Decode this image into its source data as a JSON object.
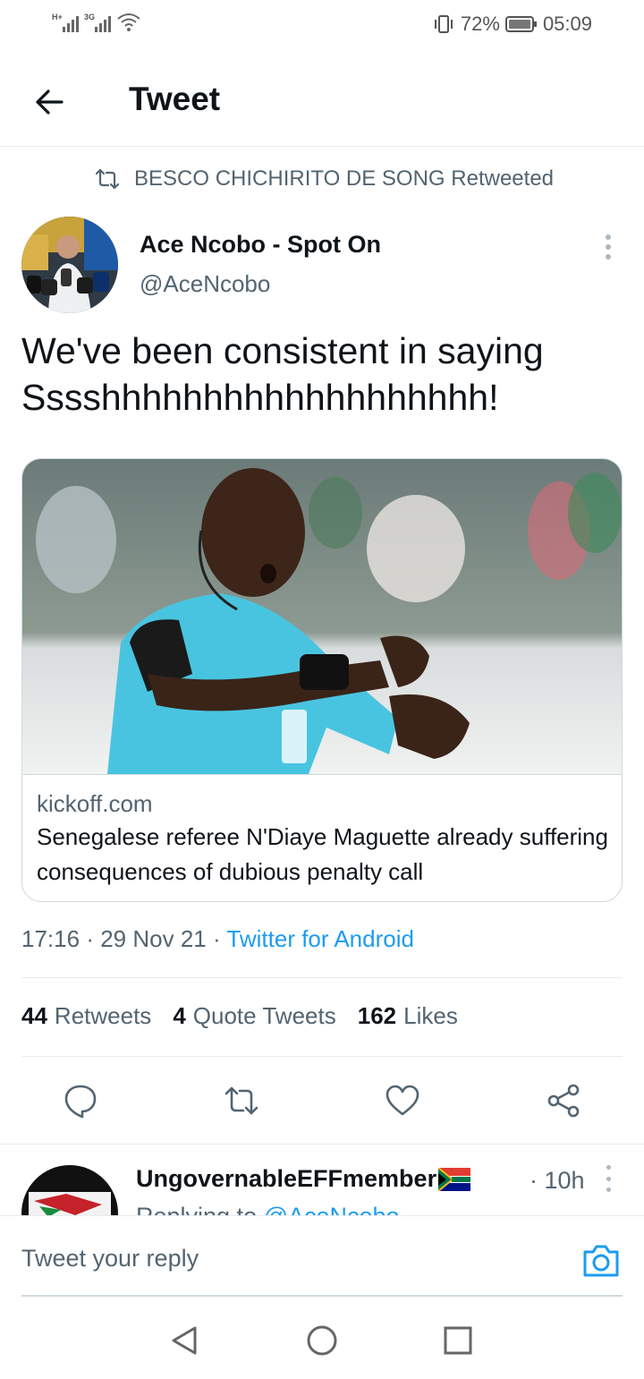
{
  "status_bar": {
    "network1": "H+",
    "network2": "3G",
    "battery": "72%",
    "time": "05:09"
  },
  "header": {
    "back_icon": "arrow-left-icon",
    "title": "Tweet"
  },
  "tweet": {
    "retweeted_by": "BESCO CHICHIRITO DE SONG Retweeted",
    "author_name": "Ace Ncobo - Spot On",
    "author_handle": "@AceNcobo",
    "text": "We've been consistent in saying Sssshhhhhhhhhhhhhhhhhhh!",
    "card": {
      "domain": "kickoff.com",
      "title": "Senegalese referee N'Diaye Maguette already suffering consequences of dubious penalty call"
    },
    "time": "17:16",
    "date": "29 Nov 21",
    "source": "Twitter for Android",
    "separator": "·",
    "stats": {
      "retweets_count": "44",
      "retweets_label": "Retweets",
      "quotes_count": "4",
      "quotes_label": "Quote Tweets",
      "likes_count": "162",
      "likes_label": "Likes"
    }
  },
  "reply_preview": {
    "name": "UngovernableEFFmember",
    "time": "· 10h",
    "replying_prefix": "Replying to ",
    "replying_handle": "@AceNcobo"
  },
  "composer": {
    "placeholder": "Tweet your reply"
  },
  "icons": {
    "reply": "reply-icon",
    "retweet": "retweet-icon",
    "like": "heart-icon",
    "share": "share-icon",
    "camera": "camera-icon"
  },
  "colors": {
    "accent": "#1d9bf0",
    "secondary_text": "#536471",
    "primary_text": "#0f1419"
  }
}
